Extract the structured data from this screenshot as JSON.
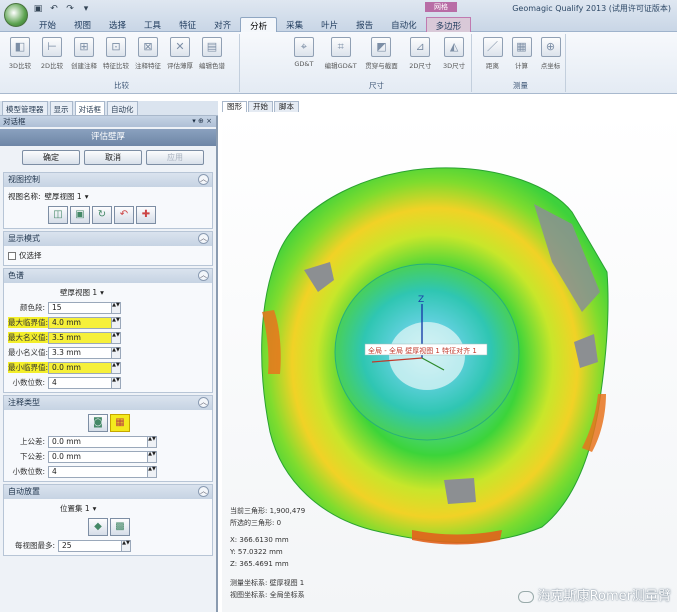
{
  "window": {
    "title": "Geomagic Qualify 2013 (试用许可证版本)",
    "context_tab_label": "网格"
  },
  "tabs": [
    "开始",
    "视图",
    "选择",
    "工具",
    "特征",
    "对齐",
    "分析",
    "采集",
    "叶片",
    "报告",
    "自动化",
    "多边形"
  ],
  "active_tab": "分析",
  "ribbon": {
    "groups": [
      {
        "name": "比较",
        "buttons": [
          "3D比较",
          "2D比较",
          "创建注释",
          "特征比较",
          "注释特征",
          "评估薄厚",
          "编辑色谱"
        ]
      },
      {
        "name": "尺寸",
        "buttons": [
          "GD&T",
          "编辑GD&T",
          "贯穿与截面",
          "2D尺寸",
          "3D尺寸"
        ]
      },
      {
        "name": "测量",
        "buttons": [
          "距离",
          "计算",
          "点坐标"
        ]
      }
    ]
  },
  "left_tabs": [
    "模型管理器",
    "显示",
    "对话框",
    "自动化"
  ],
  "left_active_tab": "对话框",
  "dialog": {
    "header": "对话框",
    "pin": "▾ ⊕ ×",
    "title": "评估壁厚",
    "buttons": {
      "ok": "确定",
      "cancel": "取消",
      "apply": "应用"
    },
    "view_control": {
      "title": "视图控制",
      "label": "视图名称:",
      "value": "壁厚视图 1"
    },
    "display_mode": {
      "title": "显示模式",
      "checkbox_label": "仅选择"
    },
    "color_spectrum": {
      "title": "色谱",
      "spectrum_value": "壁厚视图 1",
      "rows": [
        {
          "label": "颜色段:",
          "value": "15",
          "highlight": false
        },
        {
          "label": "最大临界值:",
          "value": "4.0 mm",
          "highlight": true
        },
        {
          "label": "最大名义值:",
          "value": "3.5 mm",
          "highlight": true
        },
        {
          "label": "最小名义值:",
          "value": "3.3 mm",
          "highlight": false
        },
        {
          "label": "最小临界值:",
          "value": "0.0 mm",
          "highlight": true
        },
        {
          "label": "小数位数:",
          "value": "4",
          "highlight": false
        }
      ]
    },
    "annotation_type": {
      "title": "注释类型",
      "rows": [
        {
          "label": "上公差:",
          "value": "0.0 mm"
        },
        {
          "label": "下公差:",
          "value": "0.0 mm"
        },
        {
          "label": "小数位数:",
          "value": "4"
        }
      ]
    },
    "auto_place": {
      "title": "自动放置",
      "position_value": "位置集 1",
      "max_label": "每视图最多:",
      "max_value": "25"
    }
  },
  "view_tabs": [
    "图形",
    "开始",
    "脚本"
  ],
  "view_active_tab": "图形",
  "viewport": {
    "axis_label": "Z",
    "part_label": "全局 - 全局  壁厚视图 1  特征对齐 1",
    "info": [
      "当前三角形: 1,900,479",
      "所选的三角形: 0",
      "X:  366.6130 mm",
      "Y:  57.0322 mm",
      "Z:  365.4691 mm",
      "测量坐标系: 壁厚视图 1",
      "视图坐标系: 全局坐标系"
    ],
    "watermark": "海克斯康Romer测量臂"
  },
  "colors": {
    "accent": "#6e86a6",
    "highlight": "#f6f03a",
    "context_tab": "#b86da6"
  }
}
